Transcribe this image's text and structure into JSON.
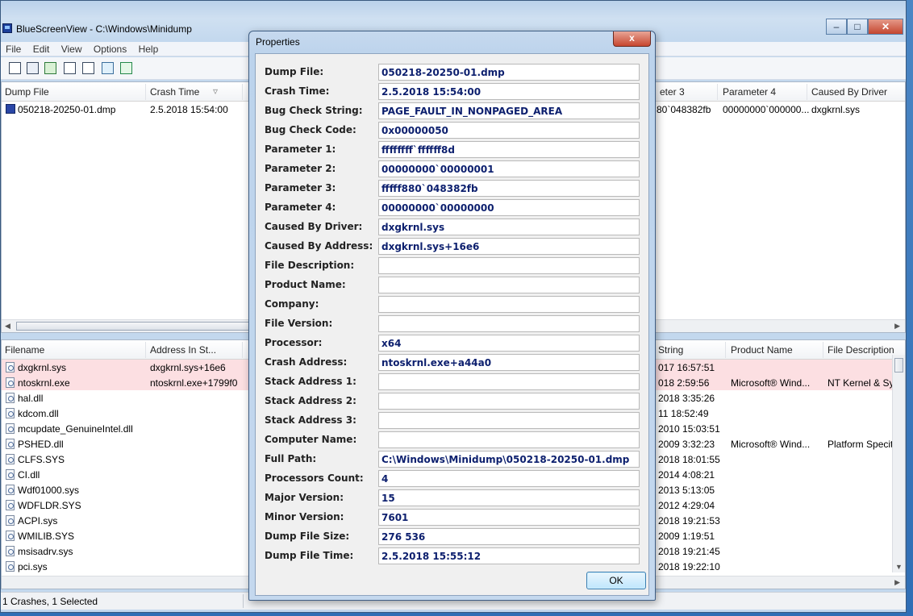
{
  "window": {
    "title": "BlueScreenView  -  C:\\Windows\\Minidump",
    "caption_buttons": [
      "minimize",
      "maximize",
      "close"
    ]
  },
  "menu": [
    "File",
    "Edit",
    "View",
    "Options",
    "Help"
  ],
  "toolbar": {
    "icons": [
      "properties-icon",
      "save-icon",
      "refresh-icon",
      "copy-icon",
      "options-icon",
      "find-icon",
      "exit-icon"
    ]
  },
  "upper_table": {
    "columns_left": [
      "Dump File",
      "Crash Time"
    ],
    "columns_right": [
      "eter 3",
      "Parameter 4",
      "Caused By Driver"
    ],
    "row": {
      "dump_file": "050218-20250-01.dmp",
      "crash_time": "2.5.2018 15:54:00",
      "param3_partial": "80`048382fb",
      "param4": "00000000`000000...",
      "driver": "dxgkrnl.sys"
    }
  },
  "lower_table": {
    "columns_left": [
      "Filename",
      "Address In St..."
    ],
    "columns_right": [
      "String",
      "Product Name",
      "File Description"
    ],
    "rows": [
      {
        "filename": "dxgkrnl.sys",
        "address": "dxgkrnl.sys+16e6",
        "time": "017 16:57:51",
        "product": "",
        "desc": "",
        "pink": true
      },
      {
        "filename": "ntoskrnl.exe",
        "address": "ntoskrnl.exe+1799f0",
        "time": "018 2:59:56",
        "product": "Microsoft® Wind...",
        "desc": "NT Kernel & Sy",
        "pink": true
      },
      {
        "filename": "hal.dll",
        "address": "",
        "time": "2018 3:35:26",
        "product": "",
        "desc": ""
      },
      {
        "filename": "kdcom.dll",
        "address": "",
        "time": "11 18:52:49",
        "product": "",
        "desc": ""
      },
      {
        "filename": "mcupdate_GenuineIntel.dll",
        "address": "",
        "time": "2010 15:03:51",
        "product": "",
        "desc": ""
      },
      {
        "filename": "PSHED.dll",
        "address": "",
        "time": "2009 3:32:23",
        "product": "Microsoft® Wind...",
        "desc": "Platform Specit"
      },
      {
        "filename": "CLFS.SYS",
        "address": "",
        "time": "2018 18:01:55",
        "product": "",
        "desc": ""
      },
      {
        "filename": "CI.dll",
        "address": "",
        "time": "2014 4:08:21",
        "product": "",
        "desc": ""
      },
      {
        "filename": "Wdf01000.sys",
        "address": "",
        "time": "2013 5:13:05",
        "product": "",
        "desc": ""
      },
      {
        "filename": "WDFLDR.SYS",
        "address": "",
        "time": "2012 4:29:04",
        "product": "",
        "desc": ""
      },
      {
        "filename": "ACPI.sys",
        "address": "",
        "time": "2018 19:21:53",
        "product": "",
        "desc": ""
      },
      {
        "filename": "WMILIB.SYS",
        "address": "",
        "time": "2009 1:19:51",
        "product": "",
        "desc": ""
      },
      {
        "filename": "msisadrv.sys",
        "address": "",
        "time": "2018 19:21:45",
        "product": "",
        "desc": ""
      },
      {
        "filename": "pci.sys",
        "address": "",
        "time": "2018 19:22:10",
        "product": "",
        "desc": ""
      }
    ]
  },
  "status": {
    "text": "1 Crashes, 1 Selected"
  },
  "dialog": {
    "title": "Properties",
    "close_label": "x",
    "ok_label": "OK",
    "fields": [
      {
        "label": "Dump File:",
        "value": "050218-20250-01.dmp"
      },
      {
        "label": "Crash Time:",
        "value": "2.5.2018 15:54:00"
      },
      {
        "label": "Bug Check String:",
        "value": "PAGE_FAULT_IN_NONPAGED_AREA"
      },
      {
        "label": "Bug Check Code:",
        "value": "0x00000050"
      },
      {
        "label": "Parameter 1:",
        "value": "ffffffff`ffffff8d"
      },
      {
        "label": "Parameter 2:",
        "value": "00000000`00000001"
      },
      {
        "label": "Parameter 3:",
        "value": "fffff880`048382fb"
      },
      {
        "label": "Parameter 4:",
        "value": "00000000`00000000"
      },
      {
        "label": "Caused By Driver:",
        "value": "dxgkrnl.sys"
      },
      {
        "label": "Caused By Address:",
        "value": "dxgkrnl.sys+16e6"
      },
      {
        "label": "File Description:",
        "value": ""
      },
      {
        "label": "Product Name:",
        "value": ""
      },
      {
        "label": "Company:",
        "value": ""
      },
      {
        "label": "File Version:",
        "value": ""
      },
      {
        "label": "Processor:",
        "value": "x64"
      },
      {
        "label": "Crash Address:",
        "value": "ntoskrnl.exe+a44a0"
      },
      {
        "label": "Stack Address 1:",
        "value": ""
      },
      {
        "label": "Stack Address 2:",
        "value": ""
      },
      {
        "label": "Stack Address 3:",
        "value": ""
      },
      {
        "label": "Computer Name:",
        "value": ""
      },
      {
        "label": "Full Path:",
        "value": "C:\\Windows\\Minidump\\050218-20250-01.dmp"
      },
      {
        "label": "Processors Count:",
        "value": "4"
      },
      {
        "label": "Major Version:",
        "value": "15"
      },
      {
        "label": "Minor Version:",
        "value": "7601"
      },
      {
        "label": "Dump File Size:",
        "value": "276 536"
      },
      {
        "label": "Dump File Time:",
        "value": "2.5.2018 15:55:12"
      }
    ]
  }
}
